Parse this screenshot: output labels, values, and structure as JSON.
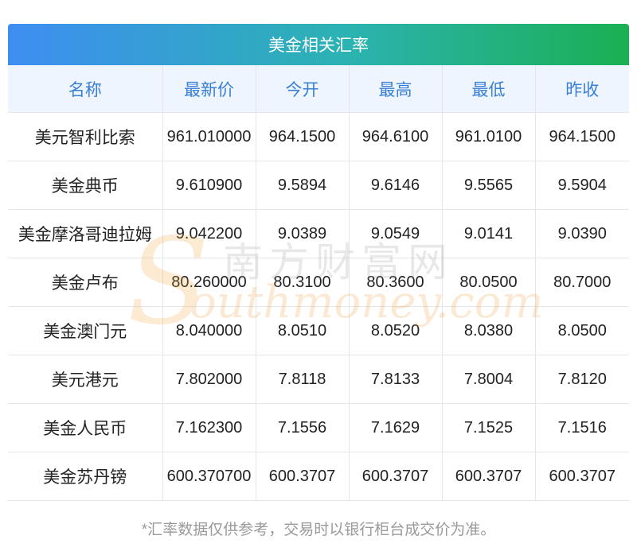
{
  "title": "美金相关汇率",
  "columns": [
    "名称",
    "最新价",
    "今开",
    "最高",
    "最低",
    "昨收"
  ],
  "rows": [
    [
      "美元智利比索",
      "961.010000",
      "964.1500",
      "964.6100",
      "961.0100",
      "964.1500"
    ],
    [
      "美金典币",
      "9.610900",
      "9.5894",
      "9.6146",
      "9.5565",
      "9.5904"
    ],
    [
      "美金摩洛哥迪拉姆",
      "9.042200",
      "9.0389",
      "9.0549",
      "9.0141",
      "9.0390"
    ],
    [
      "美金卢布",
      "80.260000",
      "80.3100",
      "80.3600",
      "80.0500",
      "80.7000"
    ],
    [
      "美金澳门元",
      "8.040000",
      "8.0510",
      "8.0520",
      "8.0380",
      "8.0500"
    ],
    [
      "美元港元",
      "7.802000",
      "7.8118",
      "7.8133",
      "7.8004",
      "7.8120"
    ],
    [
      "美金人民币",
      "7.162300",
      "7.1556",
      "7.1629",
      "7.1525",
      "7.1516"
    ],
    [
      "美金苏丹镑",
      "600.370700",
      "600.3707",
      "600.3707",
      "600.3707",
      "600.3707"
    ]
  ],
  "footnote": "*汇率数据仅供参考，交易时以银行柜台成交价为准。",
  "watermark": {
    "cn": "南方财富网",
    "en": "outhmoney.com",
    "s": "S"
  },
  "colors": {
    "header_text": "#3a7fd6",
    "header_bg": "#eef5ff",
    "title_gradient_start": "#3e8ef2",
    "title_gradient_end": "#1ab052"
  }
}
